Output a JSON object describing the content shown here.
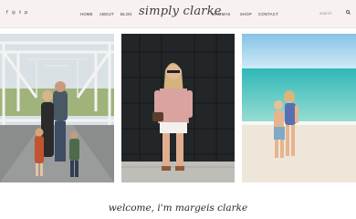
{
  "social": {
    "icons": [
      "facebook-icon",
      "instagram-icon",
      "twitter-icon",
      "pinterest-icon"
    ],
    "glyphs": [
      "f",
      "◎",
      "t",
      "p"
    ]
  },
  "nav": {
    "left": [
      "HOME",
      "ABOUT",
      "BLOG"
    ],
    "right": [
      "MAMMAS",
      "SHOP",
      "CONTACT"
    ]
  },
  "logo": "simply clarke",
  "search": {
    "placeholder": "search"
  },
  "photos": {
    "p1": "family photo on a wooden bridge",
    "p2": "woman in pink top against dark garage door",
    "p3": "two children on the beach"
  },
  "welcome": "welcome, i'm margeis clarke",
  "colors": {
    "topbar": "#f7f2ef",
    "text": "#2f2f2f"
  }
}
